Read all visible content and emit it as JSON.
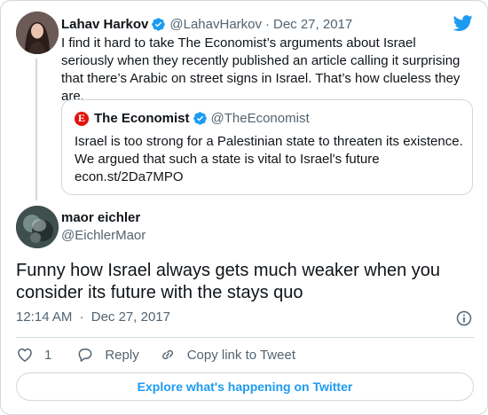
{
  "parent_tweet": {
    "name": "Lahav Harkov",
    "handle": "@LahavHarkov",
    "separator": "·",
    "date": "Dec 27, 2017",
    "text": "I find it hard to take The Economist’s arguments about Israel seriously when they recently published an article calling it surprising that there’s Arabic on street signs in Israel. That’s how clueless they are."
  },
  "quoted_tweet": {
    "logo_letter": "E",
    "name": "The Economist",
    "handle": "@TheEconomist",
    "text": "Israel is too strong for a Palestinian state to threaten its existence. We argued that such a state is vital to Israel's future econ.st/2Da7MPO"
  },
  "main_tweet": {
    "name": "maor eichler",
    "handle": "@EichlerMaor",
    "text": "Funny how Israel always gets much weaker when you consider its future with the stays quo",
    "time": "12:14 AM",
    "separator": "·",
    "date": "Dec 27, 2017"
  },
  "actions": {
    "like_count": "1",
    "reply_label": "Reply",
    "copy_link_label": "Copy link to Tweet"
  },
  "explore_label": "Explore what's happening on Twitter",
  "colors": {
    "accent": "#1d9bf0",
    "text": "#0f1419",
    "muted": "#536471",
    "border": "#cfd9de",
    "economist_red": "#e3120b"
  },
  "icons": {
    "logo": "twitter-bird-icon",
    "verified": "verified-badge-icon",
    "info": "info-icon",
    "like": "heart-icon",
    "reply": "reply-bubble-icon",
    "copy": "link-icon"
  }
}
